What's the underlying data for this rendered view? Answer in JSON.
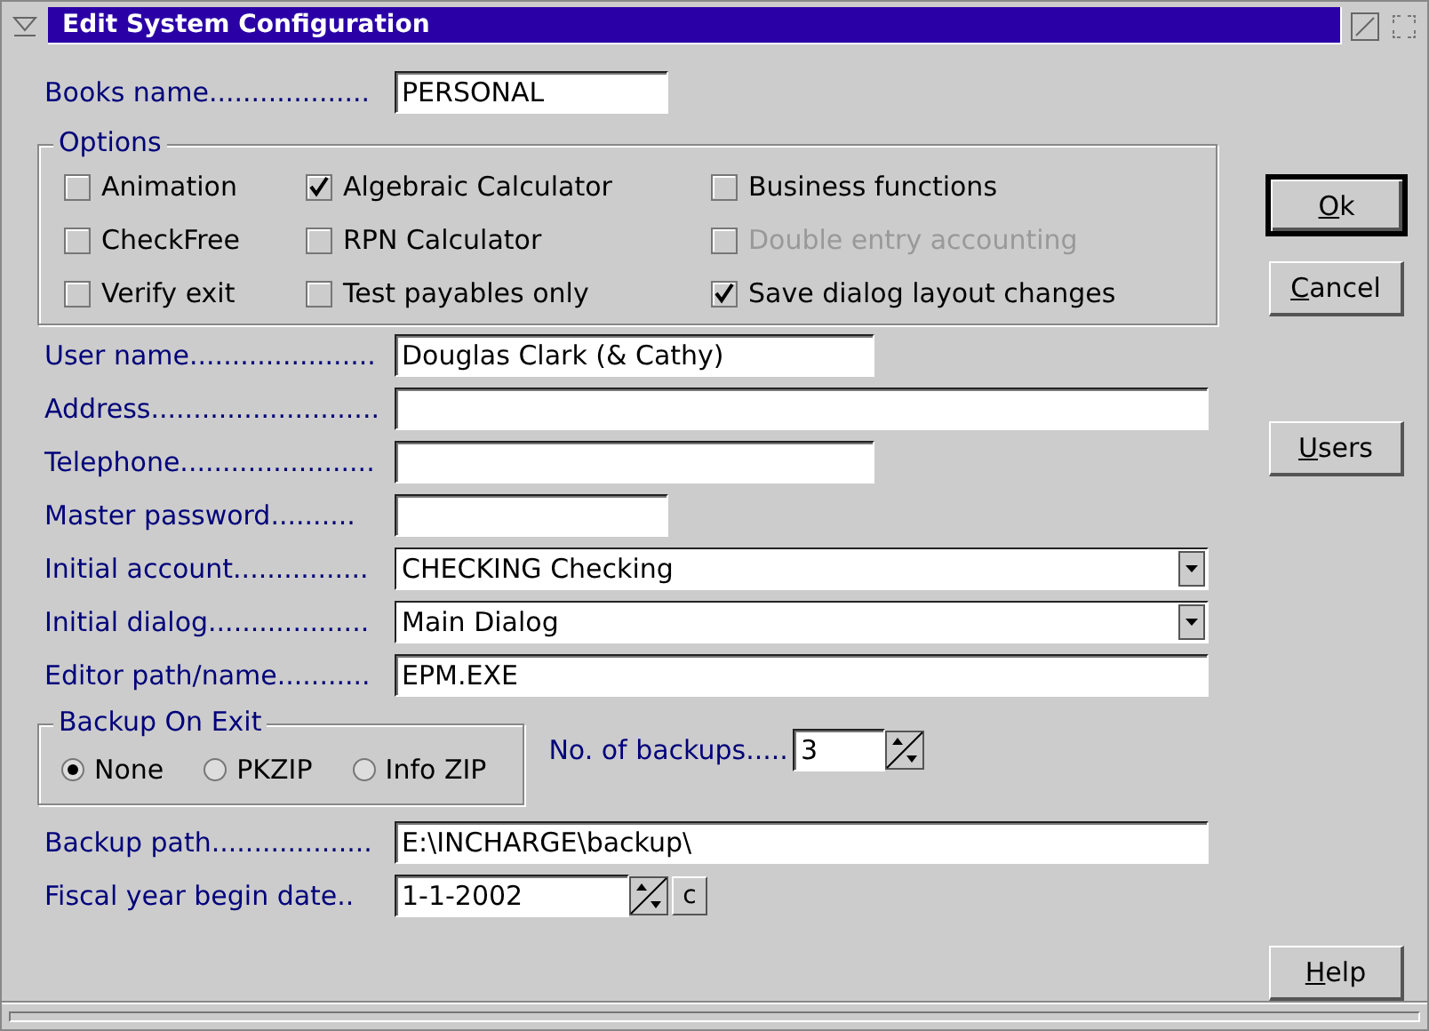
{
  "window": {
    "title": "Edit System Configuration"
  },
  "books_name": {
    "label": "Books name...................",
    "value": "PERSONAL"
  },
  "options": {
    "title": "Options",
    "items": [
      {
        "label": "Animation",
        "checked": false,
        "disabled": false
      },
      {
        "label": "Algebraic Calculator",
        "checked": true,
        "disabled": false
      },
      {
        "label": "Business functions",
        "checked": false,
        "disabled": false
      },
      {
        "label": "CheckFree",
        "checked": false,
        "disabled": false
      },
      {
        "label": "RPN Calculator",
        "checked": false,
        "disabled": false
      },
      {
        "label": "Double entry accounting",
        "checked": false,
        "disabled": true
      },
      {
        "label": "Verify exit",
        "checked": false,
        "disabled": false
      },
      {
        "label": "Test payables only",
        "checked": false,
        "disabled": false
      },
      {
        "label": "Save dialog layout changes",
        "checked": true,
        "disabled": false
      }
    ]
  },
  "fields": [
    {
      "kind": "medium",
      "label": "User name......................",
      "value": "Douglas Clark (& Cathy)"
    },
    {
      "kind": "wide",
      "label": "Address..........................."
    },
    {
      "kind": "medium",
      "label": "Telephone......................."
    },
    {
      "kind": "short",
      "label": "Master password.........."
    },
    {
      "kind": "dropdown",
      "label": "Initial account................",
      "value": "CHECKING Checking"
    },
    {
      "kind": "dropdown",
      "label": "Initial dialog...................",
      "value": "Main Dialog"
    },
    {
      "kind": "wide",
      "label": "Editor path/name...........",
      "value": "EPM.EXE"
    }
  ],
  "backup_on_exit": {
    "title": "Backup On Exit",
    "options": [
      {
        "label": "None",
        "selected": true
      },
      {
        "label": "PKZIP",
        "selected": false
      },
      {
        "label": "Info ZIP",
        "selected": false
      }
    ]
  },
  "backups": {
    "label": "No. of backups.....",
    "value": "3"
  },
  "backup_path": {
    "label": "Backup path...................",
    "value": "E:\\INCHARGE\\backup\\"
  },
  "fiscal_year": {
    "label": "Fiscal year begin date..",
    "value": "1-1-2002",
    "calendar_button": "c"
  },
  "buttons": [
    {
      "label": "Ok",
      "default": true
    },
    {
      "label": "Cancel",
      "default": false
    },
    {
      "label": "Users",
      "default": false
    },
    {
      "label": "Help",
      "default": false
    }
  ]
}
